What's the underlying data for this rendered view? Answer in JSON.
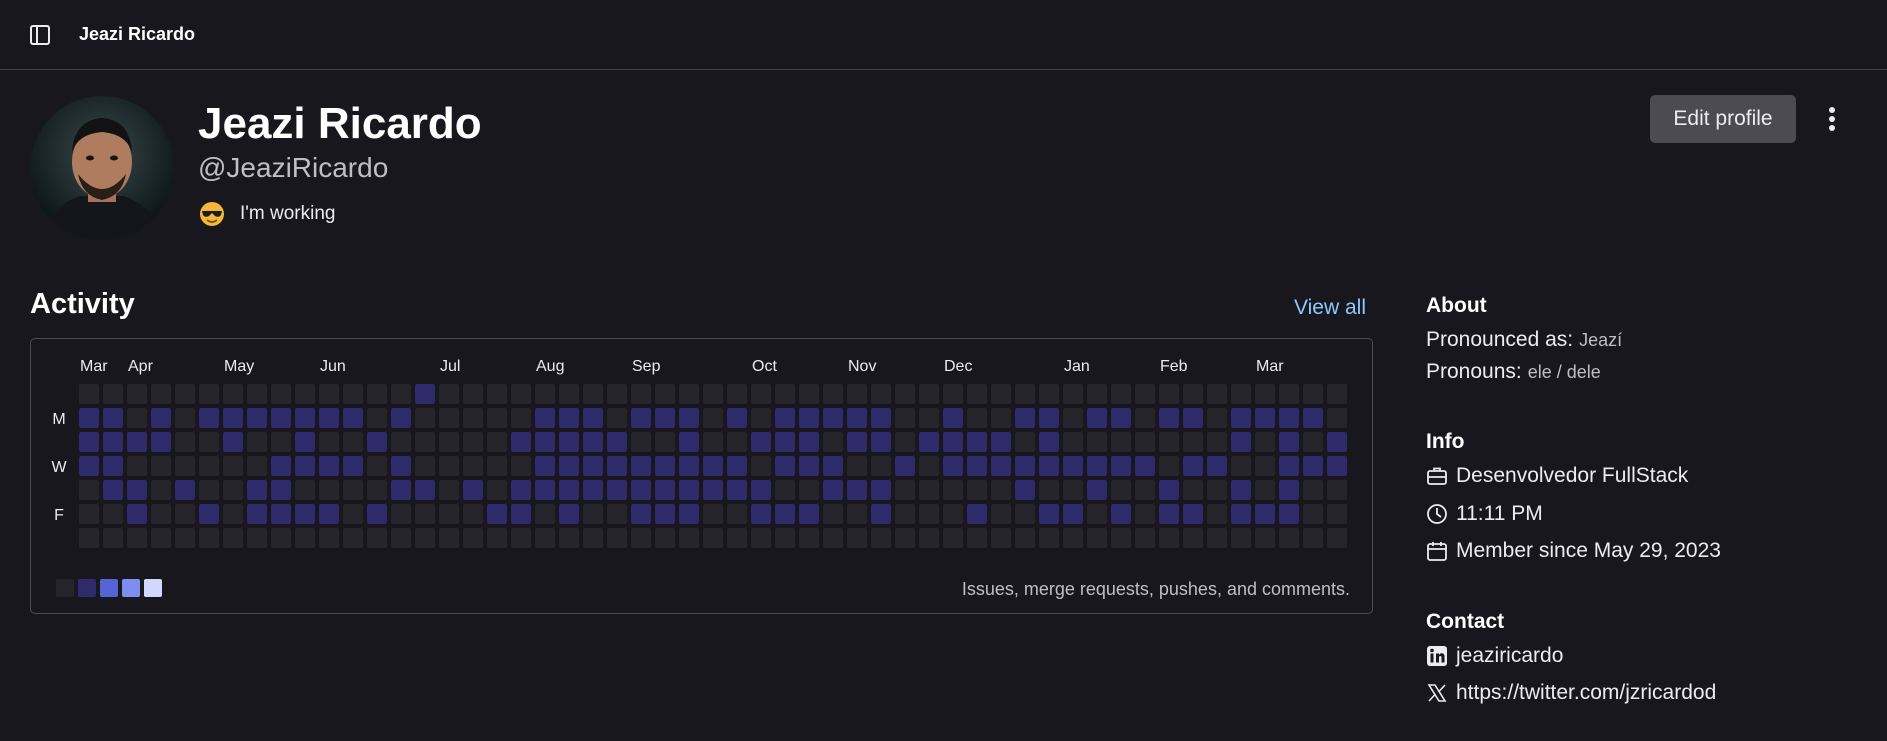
{
  "header": {
    "breadcrumb": "Jeazi Ricardo"
  },
  "profile": {
    "name": "Jeazi Ricardo",
    "handle": "@JeaziRicardo",
    "status_text": "I'm working",
    "edit_label": "Edit profile"
  },
  "activity": {
    "title": "Activity",
    "view_all": "View all",
    "note": "Issues, merge requests, pushes, and comments.",
    "day_labels": [
      "M",
      "W",
      "F"
    ],
    "months": [
      {
        "label": "Mar",
        "week": 0
      },
      {
        "label": "Apr",
        "week": 2
      },
      {
        "label": "May",
        "week": 6
      },
      {
        "label": "Jun",
        "week": 10
      },
      {
        "label": "Jul",
        "week": 15
      },
      {
        "label": "Aug",
        "week": 19
      },
      {
        "label": "Sep",
        "week": 23
      },
      {
        "label": "Oct",
        "week": 28
      },
      {
        "label": "Nov",
        "week": 32
      },
      {
        "label": "Dec",
        "week": 36
      },
      {
        "label": "Jan",
        "week": 41
      },
      {
        "label": "Feb",
        "week": 45
      },
      {
        "label": "Mar",
        "week": 49
      }
    ],
    "levels": [
      "#26252c",
      "#2f2a6b",
      "#5564d4",
      "#7e8ef0",
      "#d0d9ff"
    ],
    "grid": [
      "..............*..............................................**...",
      "**.*.*******.*.....***.***.*.*****..*..**.**.**.****..*.*",
      "****..*..*..*.....*****..*..***.**.****.*.......*.*.*****..*.",
      "**......****.*.....*********.***..*.*********.**..****.**.**.*",
      ".**.*..**....**.*.***********..***.....*..*..*..*.*..*..**.**",
      "..*..*.****.*....**.*..***..***..*...*..**.*.**.***..*..*..**",
      "................................................................."
    ]
  },
  "about": {
    "title": "About",
    "pronounced_label": "Pronounced as:",
    "pronounced_value": "Jeazí",
    "pronouns_label": "Pronouns:",
    "pronouns_value": "ele / dele"
  },
  "info": {
    "title": "Info",
    "job": "Desenvolvedor FullStack",
    "time": "11:11 PM",
    "member_since": "Member since May 29, 2023"
  },
  "contact": {
    "title": "Contact",
    "linkedin": "jeaziricardo",
    "twitter": "https://twitter.com/jzricardod"
  },
  "icons": [
    "sidebar-toggle-icon",
    "more-actions-icon",
    "briefcase-icon",
    "clock-icon",
    "calendar-icon",
    "linkedin-icon",
    "x-icon",
    "sunglasses-emoji-icon"
  ]
}
